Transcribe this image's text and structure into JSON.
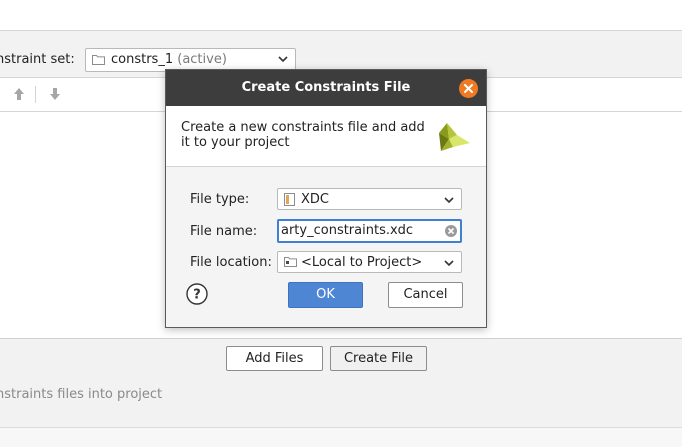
{
  "wizard": {
    "constraint_set_label": "nstraint set:",
    "constraint_set_value": "constrs_1",
    "constraint_set_status": "(active)",
    "add_files_label": "Add Files",
    "create_file_label": "Create File",
    "hint_text": "nstraints files into project"
  },
  "dialog": {
    "title": "Create Constraints File",
    "description": "Create a new constraints file and add it to your project",
    "file_type_label": "File type:",
    "file_type_value": "XDC",
    "file_name_label": "File name:",
    "file_name_value": "arty_constraints.xdc",
    "file_location_label": "File location:",
    "file_location_value": "<Local to Project>",
    "ok_label": "OK",
    "cancel_label": "Cancel"
  },
  "icons": {
    "folder": "folder-icon",
    "chevron": "chevron-down-icon",
    "up": "move-up-icon",
    "down": "move-down-icon",
    "close": "close-icon",
    "clear": "clear-icon",
    "help": "help-icon",
    "logo": "vivado-logo-icon"
  },
  "colors": {
    "accent": "#4f86d4",
    "close": "#f07a24",
    "title_bar": "#3d3d3d",
    "logo_dark": "#8a9a1a",
    "logo_light": "#d9e66a"
  }
}
